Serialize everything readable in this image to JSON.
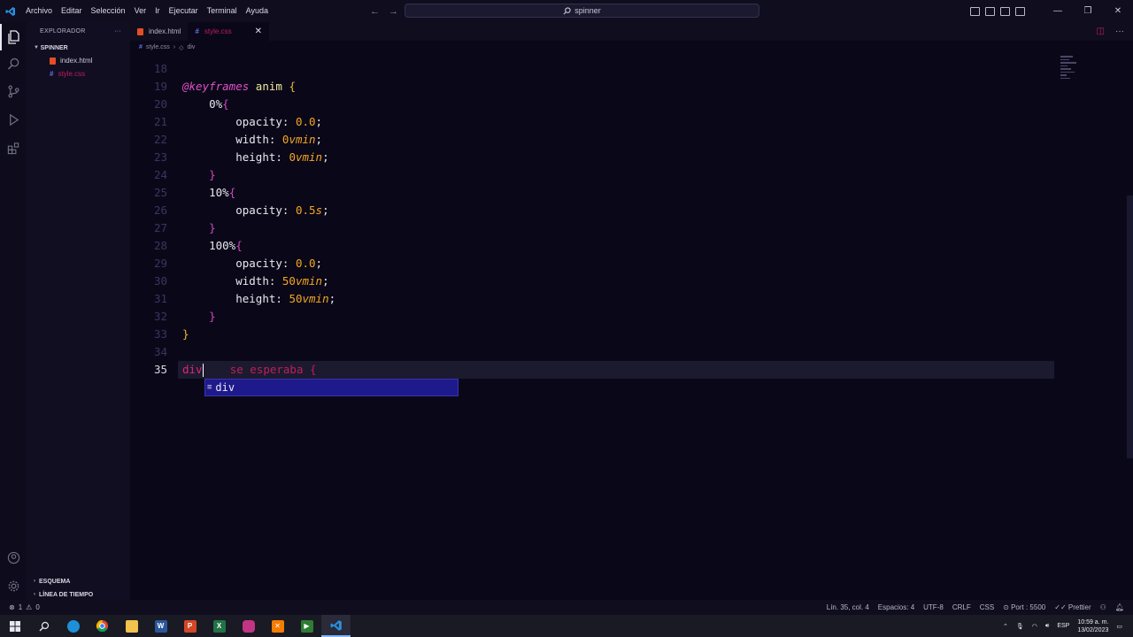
{
  "titlebar": {
    "menu": [
      "Archivo",
      "Editar",
      "Selección",
      "Ver",
      "Ir",
      "Ejecutar",
      "Terminal",
      "Ayuda"
    ],
    "search_text": "spinner"
  },
  "sidebar": {
    "title": "EXPLORADOR",
    "more": "···",
    "folder": "SPINNER",
    "files": [
      {
        "name": "index.html"
      },
      {
        "name": "style.css"
      }
    ],
    "sections": [
      "ESQUEMA",
      "LÍNEA DE TIEMPO"
    ]
  },
  "tabs": [
    {
      "label": "index.html"
    },
    {
      "label": "style.css"
    }
  ],
  "breadcrumbs": {
    "file": "style.css",
    "symbol": "div"
  },
  "editor": {
    "line_numbers": [
      "18",
      "19",
      "20",
      "21",
      "22",
      "23",
      "24",
      "25",
      "26",
      "27",
      "28",
      "29",
      "30",
      "31",
      "32",
      "33",
      "34",
      "35"
    ],
    "lines": {
      "l19": {
        "kw": "@keyframes",
        "name": "anim",
        "brace": "{"
      },
      "l20": {
        "sel": "0%",
        "brace": "{"
      },
      "l21": {
        "prop": "opacity:",
        "num": "0.0",
        "end": ";"
      },
      "l22": {
        "prop": "width:",
        "num": "0",
        "unit": "vmin",
        "end": ";"
      },
      "l23": {
        "prop": "height:",
        "num": "0",
        "unit": "vmin",
        "end": ";"
      },
      "l24": {
        "brace": "}"
      },
      "l25": {
        "sel": "10%",
        "brace": "{"
      },
      "l26": {
        "prop": "opacity:",
        "num": "0.5",
        "unit": "s",
        "end": ";"
      },
      "l27": {
        "brace": "}"
      },
      "l28": {
        "sel": "100%",
        "brace": "{"
      },
      "l29": {
        "prop": "opacity:",
        "num": "0.0",
        "end": ";"
      },
      "l30": {
        "prop": "width:",
        "num": "50",
        "unit": "vmin",
        "end": ";"
      },
      "l31": {
        "prop": "height:",
        "num": "50",
        "unit": "vmin",
        "end": ";"
      },
      "l32": {
        "brace": "}"
      },
      "l33": {
        "brace": "}"
      },
      "l35": {
        "typed": "div",
        "ghost": "se esperaba {"
      }
    },
    "suggestion": "div"
  },
  "statusbar": {
    "errors": "1",
    "warnings": "0",
    "position": "Lín. 35, col. 4",
    "spaces": "Espacios: 4",
    "encoding": "UTF-8",
    "eol": "CRLF",
    "language": "CSS",
    "port": "Port : 5500",
    "formatter": "Prettier"
  },
  "taskbar": {
    "lang": "ESP",
    "time": "10:59 a. m.",
    "date": "13/02/2023"
  },
  "colors": {
    "accent": "#c01d5e",
    "background": "#0a0818",
    "suggest_bg": "#1f1a8c"
  }
}
